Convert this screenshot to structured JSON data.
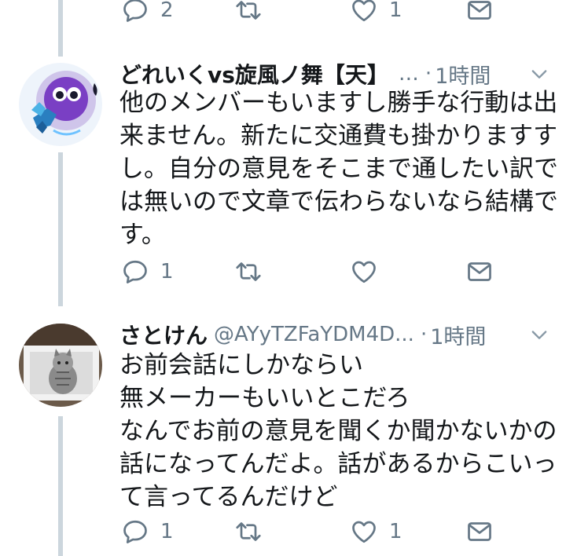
{
  "tweets": [
    {
      "counts": {
        "reply": "2",
        "retweet": "",
        "like": "1"
      }
    },
    {
      "display_name": "どれいくvs旋風ノ舞【天】",
      "handle_truncated": "…",
      "time": "1時間",
      "text_lines": [
        "他のメンバーもいますし勝手な行動は出",
        "来ません。新たに交通費も掛かりますす",
        "し。自分の意見をそこまで通したい訳で",
        "は無いので文章で伝わらないなら結構で",
        "す。"
      ],
      "counts": {
        "reply": "1",
        "retweet": "",
        "like": ""
      }
    },
    {
      "display_name": "さとけん",
      "handle": "@AYyTZFaYDM4D...",
      "time": "1時間",
      "text_lines": [
        "お前会話にしかならい",
        "無メーカーもいいとこだろ",
        "なんでお前の意見を聞くか聞かないかの",
        "話になってんだよ。話があるからこいっ",
        "て言ってるんだけど"
      ],
      "counts": {
        "reply": "1",
        "retweet": "",
        "like": "1"
      }
    }
  ],
  "icons": [
    "reply-icon",
    "retweet-icon",
    "like-icon",
    "dm-icon",
    "caret-down-icon"
  ],
  "colors": {
    "muted": "#657786",
    "text": "#14171a",
    "thread_line": "#ccd6dd"
  }
}
